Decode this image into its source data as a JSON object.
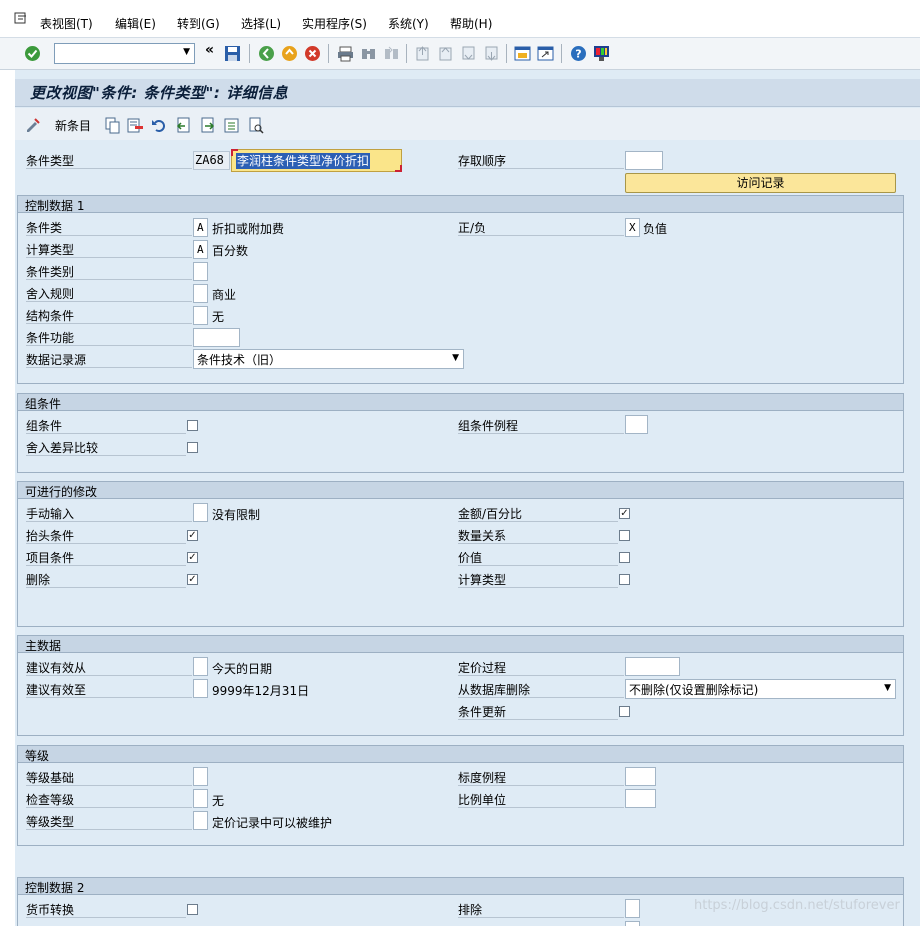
{
  "menu": [
    "表视图(T)",
    "编辑(E)",
    "转到(G)",
    "选择(L)",
    "实用程序(S)",
    "系统(Y)",
    "帮助(H)"
  ],
  "page_title": "更改视图\"条件: 条件类型\": 详细信息",
  "apptb": {
    "new_entries": "新条目"
  },
  "header": {
    "cond_type_label": "条件类型",
    "cond_type_code": "ZA68",
    "cond_type_name": "李润柱条件类型净价折扣",
    "access_seq_label": "存取顺序",
    "access_records_button": "访问记录"
  },
  "g1": {
    "title": "控制数据 1",
    "cond_class_label": "条件类",
    "cond_class_value": "A",
    "cond_class_text": "折扣或附加费",
    "plusminus_label": "正/负",
    "plusminus_value": "X",
    "plusminus_text": "负值",
    "calc_type_label": "计算类型",
    "calc_type_value": "A",
    "calc_type_text": "百分数",
    "cond_category_label": "条件类别",
    "rounding_label": "舍入规则",
    "rounding_text": "商业",
    "structure_label": "结构条件",
    "structure_text": "无",
    "cond_function_label": "条件功能",
    "data_source_label": "数据记录源",
    "data_source_value": "条件技术（旧）"
  },
  "g2": {
    "title": "组条件",
    "group_cond_label": "组条件",
    "group_routine_label": "组条件例程",
    "rounding_diff_label": "舍入差异比较"
  },
  "g3": {
    "title": "可进行的修改",
    "manual_label": "手动输入",
    "manual_text": "没有限制",
    "amount_label": "金额/百分比",
    "header_label": "抬头条件",
    "qty_rel_label": "数量关系",
    "item_label": "项目条件",
    "value_label": "价值",
    "delete_label": "删除",
    "calc_type_label": "计算类型"
  },
  "g4": {
    "title": "主数据",
    "valid_from_label": "建议有效从",
    "valid_from_text": "今天的日期",
    "pricing_proc_label": "定价过程",
    "valid_to_label": "建议有效至",
    "valid_to_text": "9999年12月31日",
    "delete_db_label": "从数据库删除",
    "delete_db_value": "不删除(仅设置删除标记)",
    "cond_update_label": "条件更新"
  },
  "g5": {
    "title": "等级",
    "scale_basis_label": "等级基础",
    "scale_routine_label": "标度例程",
    "check_scale_label": "检查等级",
    "check_scale_text": "无",
    "scale_unit_label": "比例单位",
    "scale_type_label": "等级类型",
    "scale_type_text": "定价记录中可以被维护"
  },
  "g6": {
    "title": "控制数据 2",
    "currency_label": "货币转换",
    "exclusion_label": "排除"
  },
  "checks": {
    "checked": "✓"
  },
  "watermark": "https://blog.csdn.net/stuforever",
  "colors": {
    "accent_yellow": "#fae58a",
    "group_header": "#c6d5e4",
    "bg": "#dfebf5"
  }
}
